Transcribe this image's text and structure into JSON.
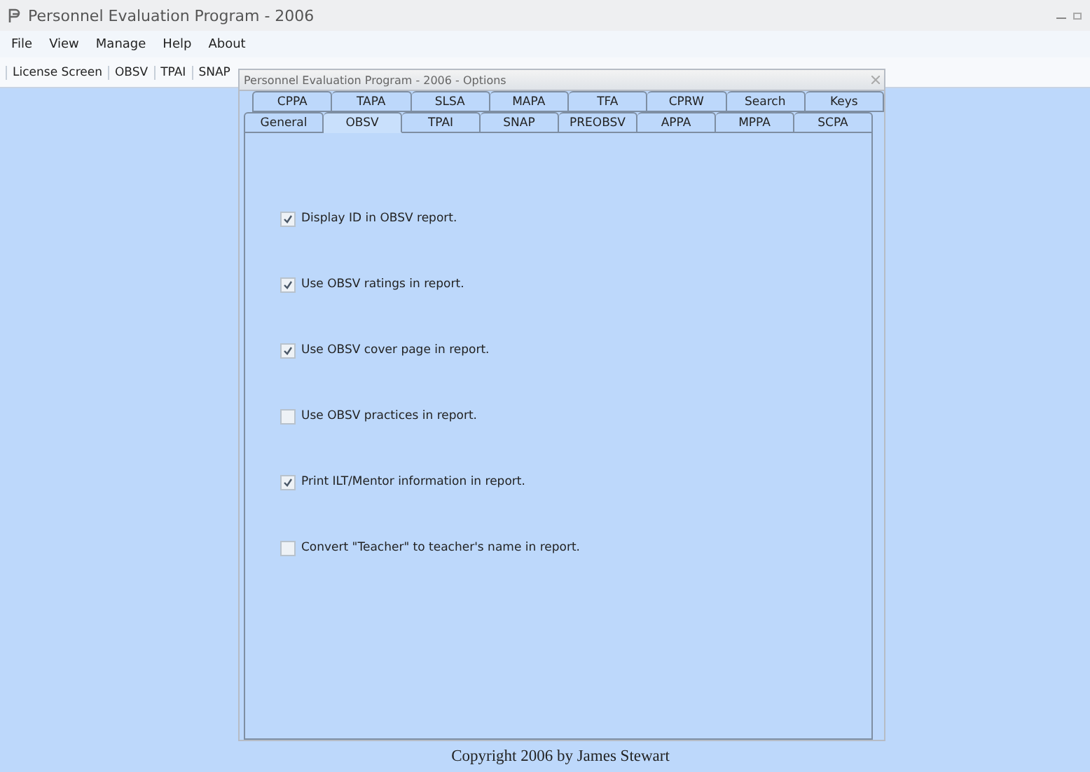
{
  "window": {
    "title": "Personnel Evaluation Program - 2006"
  },
  "menu": [
    "File",
    "View",
    "Manage",
    "Help",
    "About"
  ],
  "toolbar": [
    "License Screen",
    "OBSV",
    "TPAI",
    "SNAP"
  ],
  "dialog": {
    "title": "Personnel Evaluation Program - 2006 - Options",
    "tab_rows": [
      [
        {
          "label": "CPPA",
          "selected": false
        },
        {
          "label": "TAPA",
          "selected": false
        },
        {
          "label": "SLSA",
          "selected": false
        },
        {
          "label": "MAPA",
          "selected": false
        },
        {
          "label": "TFA",
          "selected": false
        },
        {
          "label": "CPRW",
          "selected": false
        },
        {
          "label": "Search",
          "selected": false
        },
        {
          "label": "Keys",
          "selected": false
        }
      ],
      [
        {
          "label": "General",
          "selected": false
        },
        {
          "label": "OBSV",
          "selected": true
        },
        {
          "label": "TPAI",
          "selected": false
        },
        {
          "label": "SNAP",
          "selected": false
        },
        {
          "label": "PREOBSV",
          "selected": false
        },
        {
          "label": "APPA",
          "selected": false
        },
        {
          "label": "MPPA",
          "selected": false
        },
        {
          "label": "SCPA",
          "selected": false
        }
      ]
    ],
    "options": [
      {
        "label": "Display ID in OBSV report.",
        "checked": true
      },
      {
        "label": "Use OBSV ratings in report.",
        "checked": true
      },
      {
        "label": "Use OBSV cover page in report.",
        "checked": true
      },
      {
        "label": "Use OBSV practices in report.",
        "checked": false
      },
      {
        "label": "Print ILT/Mentor information in report.",
        "checked": true
      },
      {
        "label": "Convert \"Teacher\" to teacher's name in report.",
        "checked": false
      }
    ]
  },
  "footer": "Copyright 2006 by James Stewart"
}
